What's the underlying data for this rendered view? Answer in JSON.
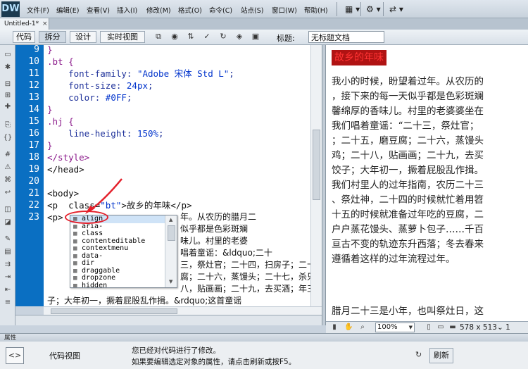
{
  "app": {
    "logo": "DW"
  },
  "menu": [
    "文件(F)",
    "编辑(E)",
    "查看(V)",
    "插入(I)",
    "修改(M)",
    "格式(O)",
    "命令(C)",
    "站点(S)",
    "窗口(W)",
    "帮助(H)"
  ],
  "menu_icons": [
    "layout-icon",
    "settings-icon",
    "sync-icon"
  ],
  "doc_tab": {
    "label": "Untitled-1*",
    "close": "×"
  },
  "toolbar": {
    "code_btn": "代码",
    "split_btn": "拆分",
    "design_btn": "设计",
    "live_btn": "实时视图",
    "title_label": "标题:",
    "title_value": "无标题文档"
  },
  "code": {
    "line_numbers": [
      "9",
      "10",
      "11",
      "12",
      "13",
      "14",
      "15",
      "16",
      "17",
      "18",
      "19",
      "20",
      "21",
      "22",
      "23"
    ],
    "lines": [
      {
        "t1": "}",
        "t2": "",
        "t3": ""
      },
      {
        "t1": ".bt {",
        "t2": "",
        "t3": ""
      },
      {
        "t1": "    font-family: ",
        "t2": "\"Adobe 宋体 Std L\"",
        "t3": ";"
      },
      {
        "t1": "    font-size: ",
        "t2": "24px",
        "t3": ";"
      },
      {
        "t1": "    color: ",
        "t2": "#0FF",
        "t3": ";"
      },
      {
        "t1": "}",
        "t2": "",
        "t3": ""
      },
      {
        "t1": ".hj {",
        "t2": "",
        "t3": ""
      },
      {
        "t1": "    line-height: ",
        "t2": "150%",
        "t3": ";"
      },
      {
        "t1": "}",
        "t2": "",
        "t3": ""
      },
      {
        "t1": "</style>",
        "t2": "",
        "t3": ""
      },
      {
        "t1": "</head>",
        "t2": "",
        "t3": ""
      },
      {
        "t1": "",
        "t2": "",
        "t3": ""
      },
      {
        "t1": "<body>",
        "t2": "",
        "t3": ""
      },
      {
        "t1": "<p  class=",
        "t2": "\"bt\"",
        "t3": ">故乡的年味</p>"
      },
      {
        "t1": "<p>",
        "t2": "",
        "t3": ""
      }
    ],
    "wrapped": [
      "年。从农历的腊月二",
      "似乎都是色彩斑斓",
      "味儿。村里的老婆",
      "唱着童谣：&ldquo;二十",
      "三，祭灶官；二十四，扫房子；二十五，磨豆",
      "腐；二十六，蒸馒头；二十七，杀只鸡；二十",
      "八，贴画画；二十九，去买酒；年三十，包饺",
      "子；大年初一，撅着屁股乱作揖。&rdquo;这首童谣"
    ]
  },
  "hint": {
    "items": [
      "align",
      "aria-",
      "class",
      "contenteditable",
      "contextmenu",
      "data-",
      "dir",
      "draggable",
      "dropzone",
      "hidden"
    ]
  },
  "design": {
    "heading": "故乡的年味",
    "lines": [
      "我小的时候，盼望着过年。从农历的",
      "，接下来的每一天似乎都是色彩斑斓",
      "馨绵厚的香味儿。村里的老婆婆坐在",
      "我们唱着童谣：“二十三，祭灶官；",
      "；二十五，磨豆腐；二十六，蒸馒头",
      "鸡；二十八，贴画画；二十九，去买",
      "饺子；大年初一，撅着屁股乱作揖。",
      "我们村里人的过年指南，农历二十三",
      "、祭灶神，二十四的时候就忙着用笤",
      "十五的时候就准备过年吃的豆腐，二",
      "户户蒸花馒头、蒸萝卜包子……千百",
      "亘古不变的轨迹东升西落；冬去春来",
      "遵循着这样的过年流程过年。"
    ],
    "last_line": "腊月二十三是小年，也叫祭灶日，这",
    "zoom": "100%",
    "size": "578 x 513⌄ 1"
  },
  "properties": {
    "title": "属性",
    "view_label": "代码视图",
    "msg1": "您已经对代码进行了修改。",
    "msg2": "如果要编辑选定对象的属性，请点击刷新或按F5。",
    "refresh": "刷新"
  },
  "colors": {
    "gutter": "#0a6fc2",
    "heading_bg": "#b01313",
    "heading_text": "#ff3333",
    "annotation": "#e4202b",
    "keyword": "#0033cc",
    "value": "#8b1a8b"
  }
}
